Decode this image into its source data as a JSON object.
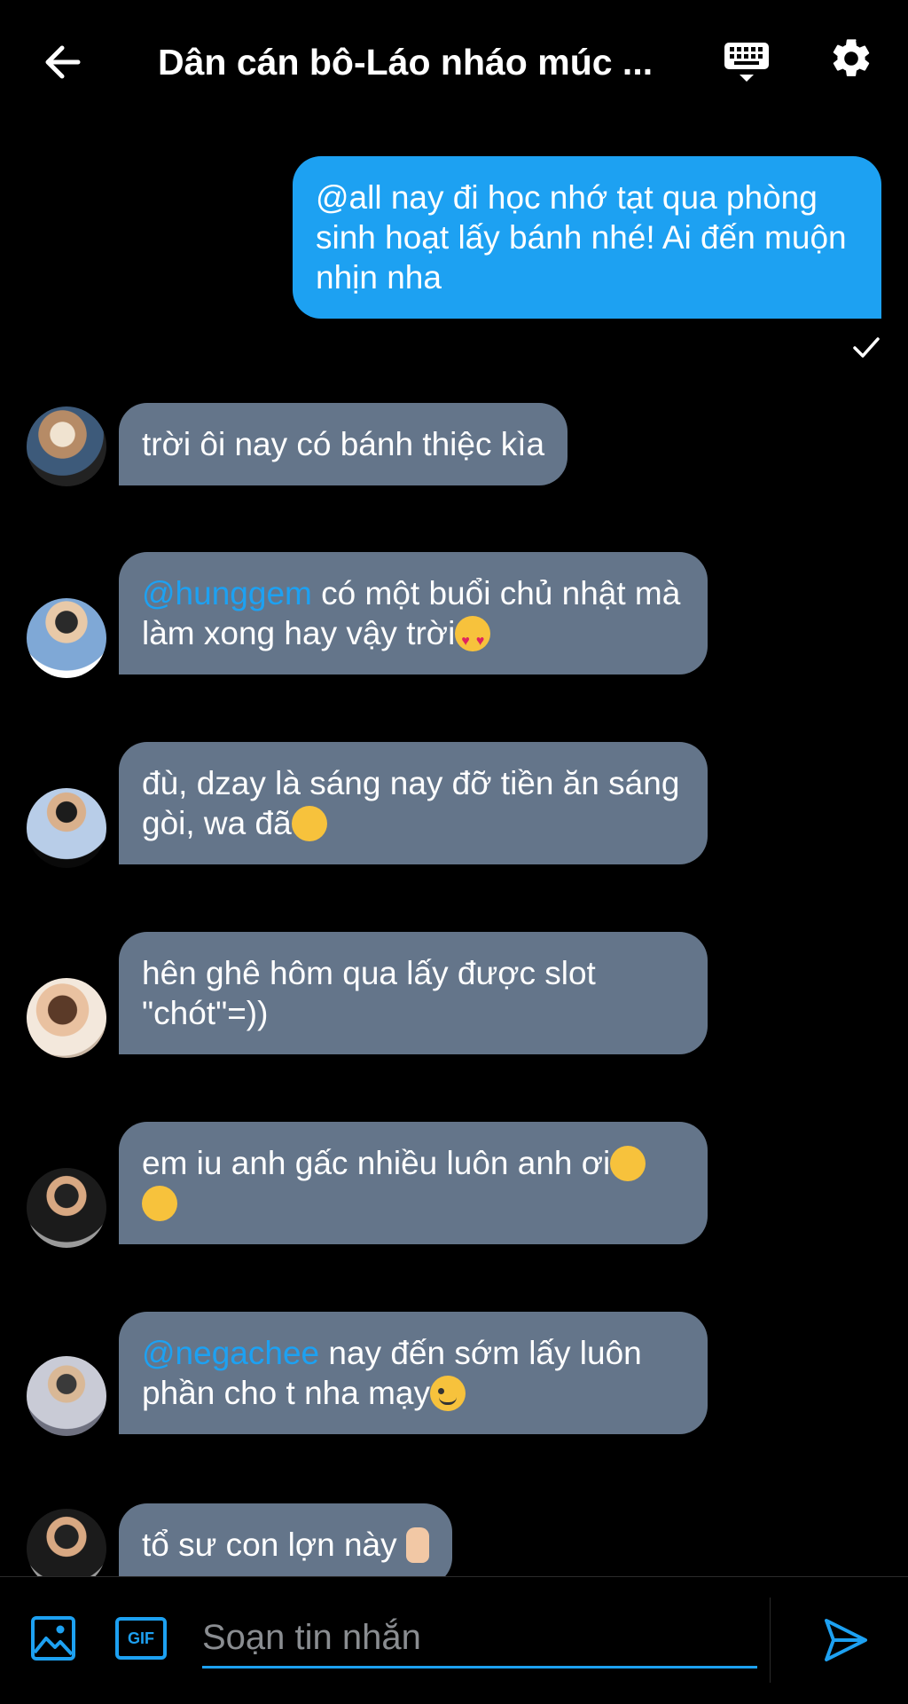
{
  "header": {
    "title": "Dân cán bô-Láo nháo múc ...",
    "back_icon": "arrow-left-icon",
    "keyboard_icon": "keyboard-icon",
    "settings_icon": "gear-icon"
  },
  "messages": [
    {
      "sender": "me",
      "text": "@all nay đi học nhớ tạt qua phòng sinh hoạt lấy bánh nhé! Ai đến muộn nhịn nha",
      "status": "sent"
    },
    {
      "sender": "them",
      "text": "trời ôi nay có bánh thiệc kìa"
    },
    {
      "sender": "them",
      "mention": "@hunggem",
      "text": " có một buổi chủ nhật mà làm xong hay vậy trời",
      "emoji": "heart-eyes-emoji"
    },
    {
      "sender": "them",
      "text": "đù, dzay là sáng nay đỡ tiền ăn sáng gòi, wa đã",
      "emoji": "hugging-emoji"
    },
    {
      "sender": "them",
      "text": "hên ghê hôm qua lấy được slot \"chót\"=))"
    },
    {
      "sender": "them",
      "text": "em iu anh gấc nhiều luôn anh ơi",
      "emoji": "kissing-emoji"
    },
    {
      "sender": "them",
      "mention": "@negachee",
      "text": " nay đến sớm lấy luôn phần cho t nha mạy",
      "emoji": "wink-emoji"
    },
    {
      "sender": "them",
      "text": "tổ sư con lợn này",
      "emoji": "middle-finger-emoji"
    }
  ],
  "composer": {
    "placeholder": "Soạn tin nhắn",
    "image_icon": "image-icon",
    "gif_label": "GIF",
    "send_icon": "send-icon"
  },
  "colors": {
    "accent": "#1da1f2",
    "incoming_bubble": "#64758a",
    "background": "#000000"
  }
}
